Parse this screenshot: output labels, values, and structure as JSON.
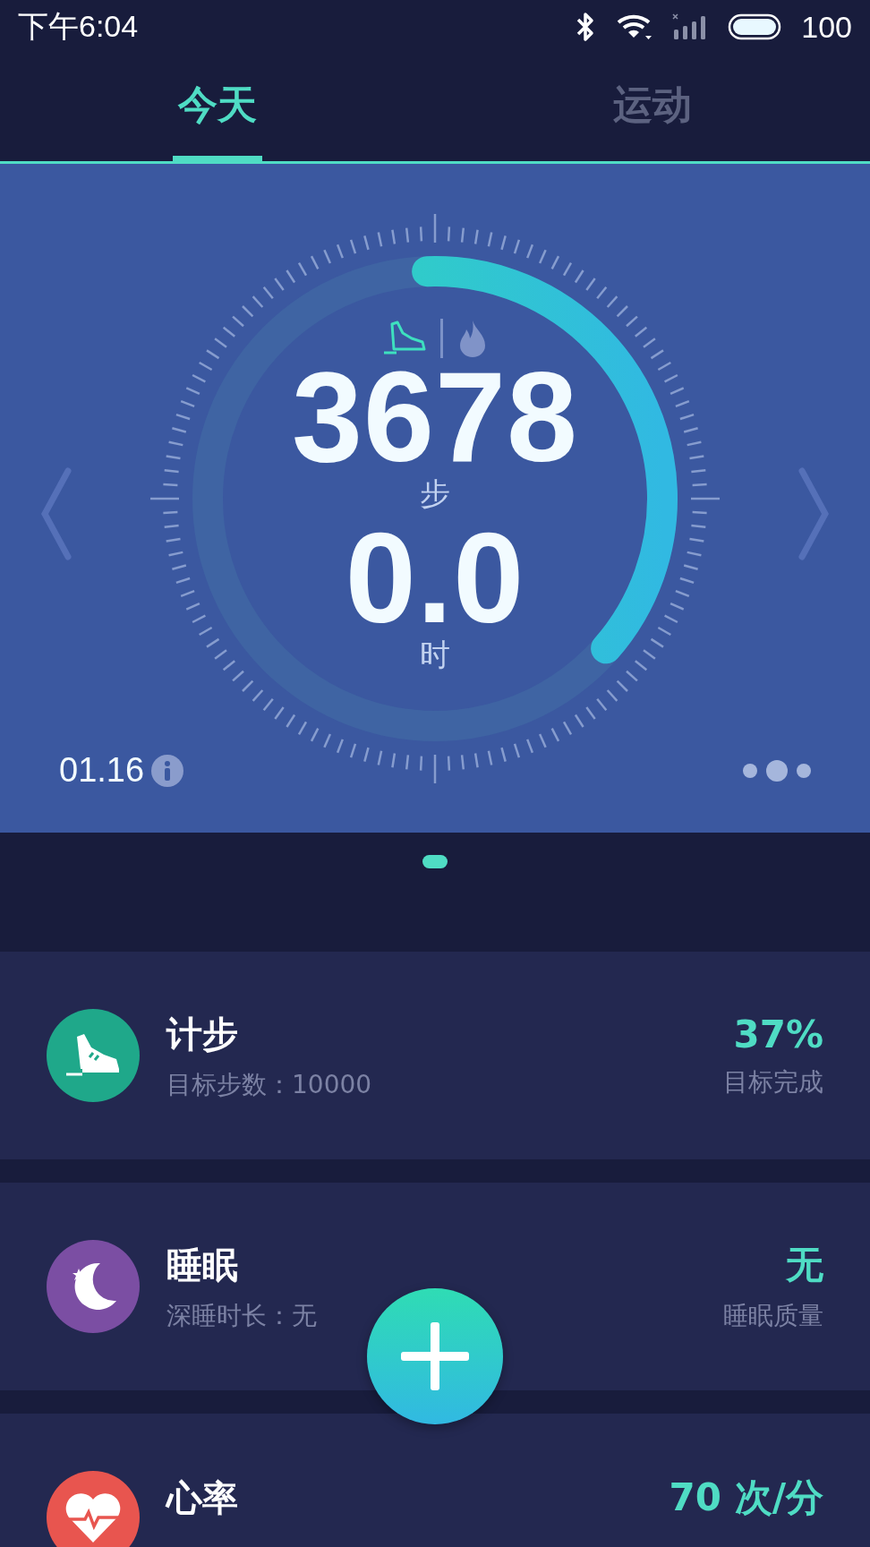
{
  "status_bar": {
    "time": "下午6:04",
    "battery": "100"
  },
  "tabs": [
    {
      "label": "今天",
      "selected": true
    },
    {
      "label": "运动",
      "selected": false
    }
  ],
  "dashboard": {
    "level": 0.37,
    "steps": "3678",
    "steps_unit": "步",
    "hours": "0.0",
    "hours_unit": "时",
    "date": "01.16",
    "pages": [
      {
        "selected": false
      },
      {
        "selected": true
      },
      {
        "selected": false
      }
    ]
  },
  "cards": [
    {
      "kind": "steps",
      "color": "#1fa88a",
      "title": "计步",
      "subtitle": "目标步数：10000",
      "value": "37%",
      "caption": "目标完成"
    },
    {
      "kind": "sleep",
      "color": "#7b4ea3",
      "title": "睡眠",
      "subtitle": "深睡时长：无",
      "value": "无",
      "caption": "睡眠质量"
    },
    {
      "kind": "heart",
      "color": "#e8554f",
      "title": "心率",
      "value": "70 次/分"
    }
  ]
}
